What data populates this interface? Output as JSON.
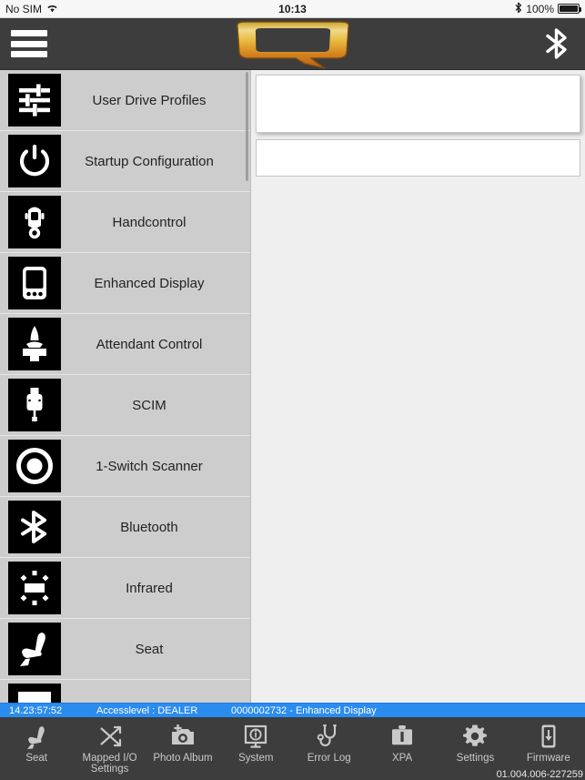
{
  "ios_status": {
    "carrier": "No SIM",
    "wifi_icon": "wifi-icon",
    "time": "10:13",
    "bluetooth_icon": "bluetooth-icon",
    "battery_percent": "100%"
  },
  "header": {
    "menu_icon": "hamburger-menu-icon",
    "logo": "q-logo",
    "bluetooth_icon": "bluetooth-icon",
    "background_color": "#3d3d3d"
  },
  "sidebar": {
    "items": [
      {
        "label": "User Drive Profiles",
        "icon": "sliders-icon"
      },
      {
        "label": "Startup Configuration",
        "icon": "power-icon"
      },
      {
        "label": "Handcontrol",
        "icon": "joystick-handcontrol-icon"
      },
      {
        "label": "Enhanced Display",
        "icon": "display-device-icon"
      },
      {
        "label": "Attendant Control",
        "icon": "attendant-joystick-icon"
      },
      {
        "label": "SCIM",
        "icon": "scim-module-icon"
      },
      {
        "label": "1-Switch Scanner",
        "icon": "circle-target-icon"
      },
      {
        "label": "Bluetooth",
        "icon": "bluetooth-icon"
      },
      {
        "label": "Infrared",
        "icon": "infrared-icon"
      },
      {
        "label": "Seat",
        "icon": "seat-icon"
      },
      {
        "label": "",
        "icon": "lighting-icon"
      }
    ]
  },
  "content": {
    "boxes": [
      {
        "name": "top-panel",
        "value": ""
      },
      {
        "name": "second-panel",
        "value": ""
      }
    ]
  },
  "status_strip": {
    "time": "14.23:57:52",
    "access_level": "Accesslevel : DEALER",
    "context": "0000002732 - Enhanced Display",
    "background_color": "#2b8cf0"
  },
  "toolbar": {
    "items": [
      {
        "label": "Seat",
        "icon": "seat-icon"
      },
      {
        "label": "Mapped I/O\nSettings",
        "icon": "mapped-io-icon"
      },
      {
        "label": "Photo Album",
        "icon": "camera-plus-icon"
      },
      {
        "label": "System",
        "icon": "monitor-info-icon"
      },
      {
        "label": "Error Log",
        "icon": "stethoscope-icon"
      },
      {
        "label": "XPA",
        "icon": "briefcase-icon"
      },
      {
        "label": "Settings",
        "icon": "gear-icon"
      },
      {
        "label": "Firmware",
        "icon": "device-download-icon"
      }
    ],
    "firmware_version": "01.004.006-227259"
  }
}
